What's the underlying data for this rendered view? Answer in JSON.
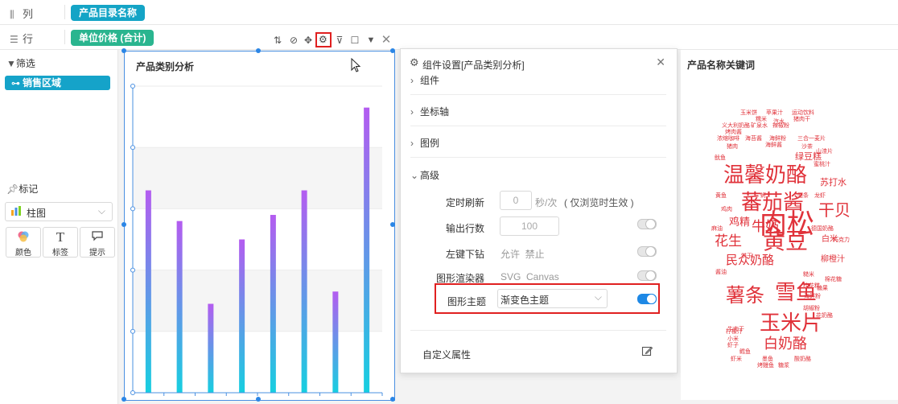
{
  "shelf": {
    "columns": {
      "label": "列",
      "icon": "columns-icon",
      "pill": "产品目录名称"
    },
    "rows": {
      "label": "行",
      "icon": "rows-icon",
      "pill": "单位价格 (合计)"
    }
  },
  "left_panel": {
    "filter": {
      "title": "筛选",
      "chip": "销售区域"
    },
    "marks": {
      "title": "标记",
      "chart_type": "柱图",
      "buttons": [
        {
          "label": "颜色",
          "icon": "color-icon"
        },
        {
          "label": "标签",
          "icon": "text-label-icon",
          "glyph": "T"
        },
        {
          "label": "提示",
          "icon": "tooltip-icon"
        }
      ]
    }
  },
  "chart": {
    "title": "产品类别分析",
    "chart_data": {
      "type": "bar",
      "categories": [
        "",
        "",
        "",
        "",
        "",
        "",
        "",
        ""
      ],
      "values": [
        66,
        56,
        29,
        50,
        58,
        66,
        33,
        93
      ],
      "ylim": [
        0,
        100
      ],
      "xlabel": "",
      "ylabel": "",
      "grid": true,
      "colors": {
        "top": "#b45cf0",
        "bottom": "#16cfe0"
      }
    }
  },
  "dialog": {
    "title": "组件设置[产品类别分析]",
    "sections": [
      "组件",
      "坐标轴",
      "图例",
      "高级"
    ],
    "advanced": {
      "refresh": {
        "label": "定时刷新",
        "value": "0",
        "unit": "秒/次",
        "note": "( 仅浏览时生效 )"
      },
      "rows": {
        "label": "输出行数",
        "value": "100",
        "enabled": false
      },
      "drill": {
        "label": "左键下钻",
        "options": "允许  禁止",
        "enabled": false
      },
      "renderer": {
        "label": "图形渲染器",
        "options": "SVG  Canvas",
        "enabled": false
      },
      "theme": {
        "label": "图形主题",
        "value": "渐变色主题",
        "enabled": true
      }
    },
    "custom": {
      "label": "自定义属性"
    }
  },
  "wordcloud": {
    "title": "产品名称关键词",
    "words": [
      {
        "text": "肉松",
        "size": 34
      },
      {
        "text": "温馨奶酪",
        "size": 26
      },
      {
        "text": "蕃茄酱",
        "size": 26
      },
      {
        "text": "黄豆",
        "size": 28
      },
      {
        "text": "雪鱼",
        "size": 26
      },
      {
        "text": "薯条",
        "size": 24
      },
      {
        "text": "玉米片",
        "size": 26
      },
      {
        "text": "白奶酪",
        "size": 18
      },
      {
        "text": "牛奶",
        "size": 17
      },
      {
        "text": "干贝",
        "size": 20
      },
      {
        "text": "花生",
        "size": 17
      },
      {
        "text": "民众奶酪",
        "size": 15
      },
      {
        "text": "鸡精",
        "size": 13
      },
      {
        "text": "绿豆糕",
        "size": 11
      },
      {
        "text": "苏打水",
        "size": 11
      },
      {
        "text": "白米",
        "size": 10
      },
      {
        "text": "柳橙汁",
        "size": 10
      },
      {
        "text": "玉米饼",
        "size": 7
      },
      {
        "text": "苹果汁",
        "size": 7
      },
      {
        "text": "运动饮料",
        "size": 7
      },
      {
        "text": "义大利奶酪",
        "size": 7
      },
      {
        "text": "矿泉水",
        "size": 7
      },
      {
        "text": "猪肉干",
        "size": 7
      },
      {
        "text": "糯米",
        "size": 7
      },
      {
        "text": "汽水",
        "size": 7
      },
      {
        "text": "辣椒粉",
        "size": 7
      },
      {
        "text": "浓缩咖啡",
        "size": 7
      },
      {
        "text": "海苔酱",
        "size": 7
      },
      {
        "text": "海鲜粉",
        "size": 7
      },
      {
        "text": "三合一麦片",
        "size": 7
      },
      {
        "text": "猪肉",
        "size": 7
      },
      {
        "text": "海鲜酱",
        "size": 7
      },
      {
        "text": "沙茶",
        "size": 7
      },
      {
        "text": "山渣片",
        "size": 7
      },
      {
        "text": "鱿鱼",
        "size": 7
      },
      {
        "text": "蜜桃汁",
        "size": 7
      },
      {
        "text": "烤肉酱",
        "size": 7
      },
      {
        "text": "黄鱼",
        "size": 7
      },
      {
        "text": "蚵",
        "size": 7
      },
      {
        "text": "面条",
        "size": 7
      },
      {
        "text": "龙虾",
        "size": 7
      },
      {
        "text": "鸡肉",
        "size": 7
      },
      {
        "text": "麻油",
        "size": 7
      },
      {
        "text": "德国奶酪",
        "size": 7
      },
      {
        "text": "巧克力",
        "size": 7
      },
      {
        "text": "饼干",
        "size": 7
      },
      {
        "text": "酱油",
        "size": 7
      },
      {
        "text": "糙米",
        "size": 7
      },
      {
        "text": "桂花糕",
        "size": 7
      },
      {
        "text": "棉花糖",
        "size": 7
      },
      {
        "text": "糖果",
        "size": 7
      },
      {
        "text": "海鲜粉",
        "size": 7
      },
      {
        "text": "胡椒粉",
        "size": 7
      },
      {
        "text": "花奶酪",
        "size": 7
      },
      {
        "text": "牛肉干",
        "size": 7
      },
      {
        "text": "柠檬汁",
        "size": 7
      },
      {
        "text": "小米",
        "size": 7
      },
      {
        "text": "虾子",
        "size": 7
      },
      {
        "text": "鳕鱼",
        "size": 7
      },
      {
        "text": "虾米",
        "size": 7
      },
      {
        "text": "墨鱼",
        "size": 7
      },
      {
        "text": "烤鳗鱼",
        "size": 7
      },
      {
        "text": "糖浆",
        "size": 7
      },
      {
        "text": "酸奶酪",
        "size": 7
      }
    ]
  }
}
